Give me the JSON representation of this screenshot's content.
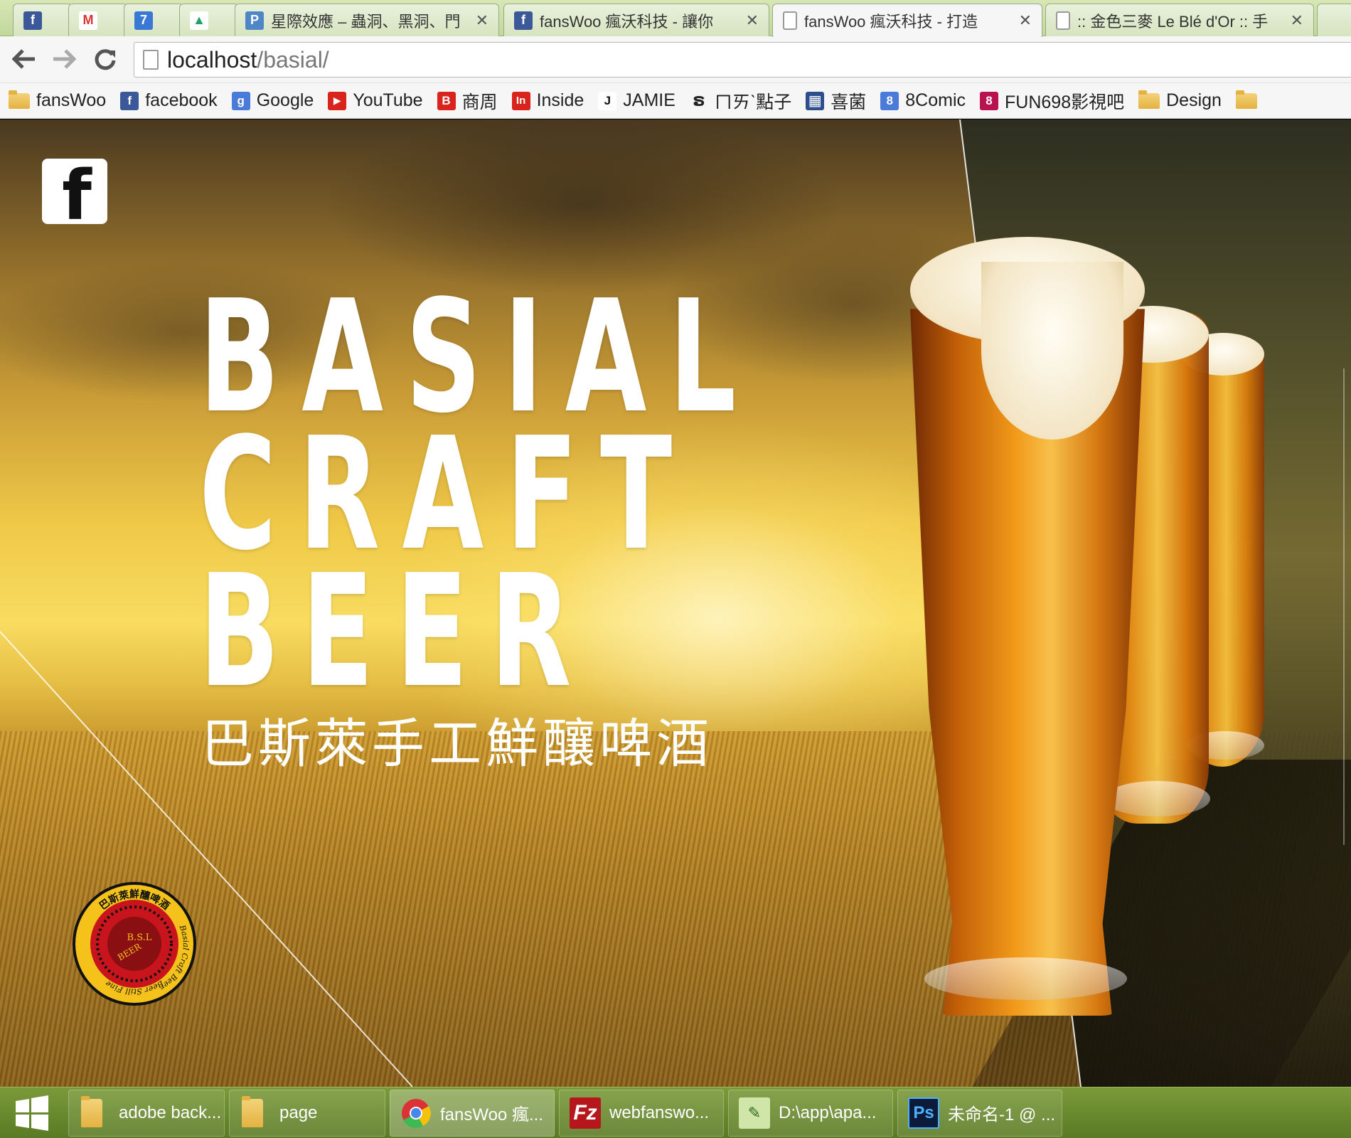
{
  "browser": {
    "tabs": [
      {
        "title": "",
        "icon": "facebook-icon",
        "color": "#3b5998",
        "glyph": "f"
      },
      {
        "title": "",
        "icon": "gmail-icon",
        "color": "#ffffff",
        "glyph": "M"
      },
      {
        "title": "",
        "icon": "calendar-icon",
        "color": "#3a78d6",
        "glyph": "7"
      },
      {
        "title": "",
        "icon": "google-drive-icon",
        "color": "#ffffff",
        "glyph": "▲"
      },
      {
        "title": "星際效應 – 蟲洞、黑洞、門",
        "icon": "page-icon",
        "color": "#4f86c6",
        "glyph": "P"
      },
      {
        "title": "fansWoo 瘋沃科技 - 讓你",
        "icon": "facebook-icon",
        "color": "#3b5998",
        "glyph": "f"
      },
      {
        "title": "fansWoo 瘋沃科技 - 打造",
        "icon": "page-icon",
        "color": "#ffffff",
        "glyph": ""
      },
      {
        "title": ":: 金色三麥 Le Blé d'Or :: 手",
        "icon": "page-icon",
        "color": "#ffffff",
        "glyph": ""
      }
    ],
    "url_host": "localhost",
    "url_path": "/basial/",
    "bookmarks": [
      {
        "label": "fansWoo",
        "icon": "folder-icon"
      },
      {
        "label": "facebook",
        "icon": "facebook-icon",
        "color": "#3b5998",
        "glyph": "f"
      },
      {
        "label": "Google",
        "icon": "google-icon",
        "color": "#4a7bd8",
        "glyph": "g"
      },
      {
        "label": "YouTube",
        "icon": "youtube-icon",
        "color": "#d9231d",
        "glyph": "▶"
      },
      {
        "label": "商周",
        "icon": "business-weekly-icon",
        "color": "#d9231d",
        "glyph": "B"
      },
      {
        "label": "Inside",
        "icon": "inside-icon",
        "color": "#d9231d",
        "glyph": "In"
      },
      {
        "label": "JAMIE",
        "icon": "jamie-icon",
        "color": "#ffffff",
        "glyph": "J"
      },
      {
        "label": "ㄇㄞˋ點子",
        "icon": "idea-icon",
        "color": "#ffffff",
        "glyph": "ຣ"
      },
      {
        "label": "喜菌",
        "icon": "grid-icon",
        "color": "#2d4f8c",
        "glyph": "▦"
      },
      {
        "label": "8Comic",
        "icon": "comic-icon",
        "color": "#4a7bd8",
        "glyph": "8"
      },
      {
        "label": "FUN698影視吧",
        "icon": "fun698-icon",
        "color": "#b8124f",
        "glyph": "8"
      },
      {
        "label": "Design",
        "icon": "folder-icon"
      }
    ]
  },
  "page": {
    "hero_line_1": "BASIAL",
    "hero_line_2": "CRAFT",
    "hero_line_3": "BEER",
    "hero_subtitle": "巴斯萊手工鮮釀啤酒",
    "facebook_glyph": "f",
    "seal": {
      "top_text": "巴斯萊鮮釀啤酒",
      "right_text": "Basial Craft Beer",
      "bottom_text": "Beer Still Fine",
      "center_text_1": "B.S.L",
      "center_text_2": "BEER"
    }
  },
  "taskbar": {
    "items": [
      {
        "label": "adobe back...",
        "icon": "folder-icon",
        "active": false
      },
      {
        "label": "page",
        "icon": "folder-icon",
        "active": false
      },
      {
        "label": "fansWoo 瘋...",
        "icon": "chrome-icon",
        "active": true
      },
      {
        "label": "webfanswo...",
        "icon": "filezilla-icon",
        "active": false
      },
      {
        "label": "D:\\app\\apa...",
        "icon": "notepad-icon",
        "active": false
      },
      {
        "label": "未命名-1 @ ...",
        "icon": "photoshop-icon",
        "active": false
      }
    ]
  },
  "colors": {
    "tab_strip": "#c1d89a",
    "taskbar": "#5a7a24",
    "facebook_blue": "#3b5998",
    "seal_red": "#c8151d",
    "seal_yellow": "#f4c21a"
  }
}
